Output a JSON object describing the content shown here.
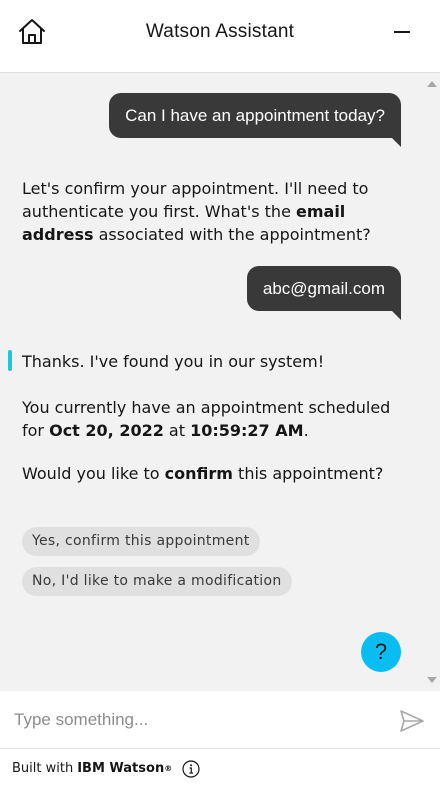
{
  "header": {
    "title": "Watson Assistant",
    "home_icon": "home-icon",
    "minimize_icon": "minimize-icon"
  },
  "messages": {
    "user_1": "Can I have an appointment today?",
    "bot_1": {
      "part1": "Let's confirm your appointment. I'll need to authenticate you first. What's the ",
      "bold": "email address",
      "part2": " associated with the appointment?"
    },
    "user_2": "abc@gmail.com",
    "bot_2": {
      "line1": "Thanks. I've found you in our system!",
      "line2_a": "You currently have an appointment scheduled for ",
      "date": "Oct 20, 2022",
      "line2_b": " at ",
      "time": "10:59:27 AM",
      "line2_c": ".",
      "line3_a": "Would you like to ",
      "confirm": "confirm",
      "line3_b": " this appointment?"
    },
    "options": [
      "Yes, confirm this appointment",
      "No, I'd like to make a modification"
    ]
  },
  "help": {
    "label": "?"
  },
  "input": {
    "placeholder": "Type something...",
    "value": ""
  },
  "footer": {
    "prefix": "Built with",
    "brand": "IBM Watson",
    "reg": "®"
  },
  "colors": {
    "user_bubble": "#393939",
    "accent": "#1ec8dc",
    "help_button": "#08bdf2",
    "chat_bg": "#f2f2f2"
  }
}
